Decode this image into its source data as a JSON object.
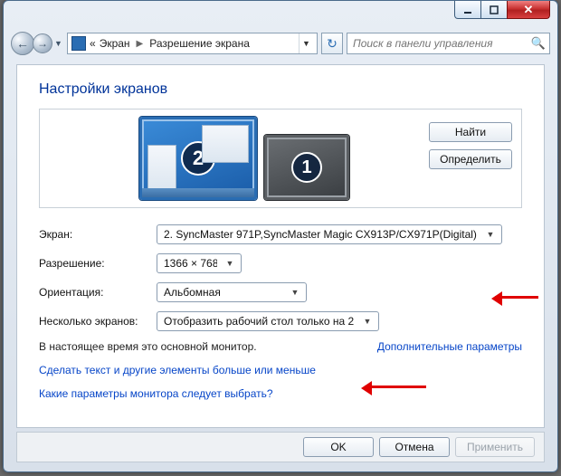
{
  "breadcrumb": {
    "node1": "Экран",
    "node2": "Разрешение экрана",
    "prefix": "«"
  },
  "search": {
    "placeholder": "Поиск в панели управления"
  },
  "title": "Настройки экранов",
  "preview": {
    "identify_btn": "Найти",
    "detect_btn": "Определить",
    "monitors": [
      {
        "num": "2",
        "primary": true
      },
      {
        "num": "1",
        "primary": false
      }
    ]
  },
  "labels": {
    "screen": "Экран:",
    "resolution": "Разрешение:",
    "orientation": "Ориентация:",
    "multi": "Несколько экранов:"
  },
  "values": {
    "screen": "2. SyncMaster 971P,SyncMaster Magic CX913P/CX971P(Digital)",
    "resolution": "1366 × 768",
    "orientation": "Альбомная",
    "multi": "Отобразить рабочий стол только на 2"
  },
  "status_text": "В настоящее время это основной монитор.",
  "right_link": "Дополнительные параметры",
  "link1": "Сделать текст и другие элементы больше или меньше",
  "link2": "Какие параметры монитора следует выбрать?",
  "buttons": {
    "ok": "OK",
    "cancel": "Отмена",
    "apply": "Применить"
  }
}
